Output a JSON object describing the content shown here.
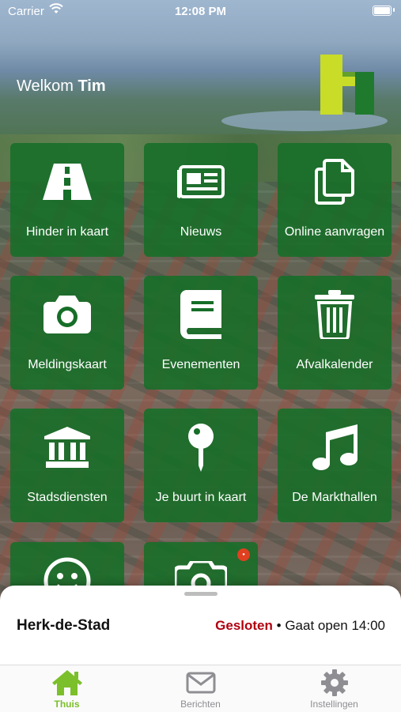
{
  "status_bar": {
    "carrier": "Carrier",
    "time": "12:08 PM"
  },
  "header": {
    "greeting": "Welkom",
    "user_name": "Tim"
  },
  "tiles": [
    {
      "label": "Hinder in kaart",
      "icon": "road-icon"
    },
    {
      "label": "Nieuws",
      "icon": "newspaper-icon"
    },
    {
      "label": "Online aanvragen",
      "icon": "documents-icon"
    },
    {
      "label": "Meldingskaart",
      "icon": "camera-icon"
    },
    {
      "label": "Evenementen",
      "icon": "book-icon"
    },
    {
      "label": "Afvalkalender",
      "icon": "trash-icon"
    },
    {
      "label": "Stadsdiensten",
      "icon": "building-icon"
    },
    {
      "label": "Je buurt in kaart",
      "icon": "map-pin-icon"
    },
    {
      "label": "De Markthallen",
      "icon": "music-note-icon"
    },
    {
      "label": "",
      "icon": "smiley-icon"
    },
    {
      "label": "",
      "icon": "photo-camera-icon"
    }
  ],
  "location_sheet": {
    "name": "Herk-de-Stad",
    "status": "Gesloten",
    "separator": "•",
    "opening_text": "Gaat open 14:00"
  },
  "tab_bar": {
    "active_color": "#7bbf2a",
    "inactive_color": "#8e8e93",
    "tabs": [
      {
        "label": "Thuis",
        "icon": "home-icon",
        "active": true
      },
      {
        "label": "Berichten",
        "icon": "envelope-icon",
        "active": false
      },
      {
        "label": "Instellingen",
        "icon": "gear-icon",
        "active": false
      }
    ]
  },
  "colors": {
    "tile_green": "#166e28",
    "logo_lime": "#c8dc28",
    "logo_green": "#1f7a2e",
    "closed_red": "#b00010"
  }
}
